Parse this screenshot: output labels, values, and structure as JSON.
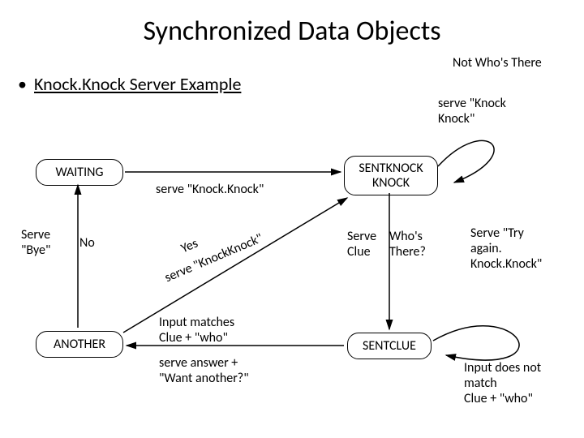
{
  "title": "Synchronized Data Objects",
  "subtitle": "Knock.Knock Server Example",
  "top_right": "Not Who's There",
  "states": {
    "waiting": "WAITING",
    "sentknock": "SENTKNOCK\nKNOCK",
    "another": "ANOTHER",
    "sentclue": "SENTCLUE"
  },
  "labels": {
    "serve_kk_top": "serve \"Knock\nKnock\"",
    "serve_kk_mid": "serve \"Knock.Knock\"",
    "serve_bye": "Serve\n\"Bye\"",
    "no": "No",
    "yes": "Yes",
    "serve_kk_diag": "serve \"KnockKnock\"",
    "whos_there": "Who's\nThere?",
    "serve_clue": "Serve\nClue",
    "try_again": "Serve \"Try\nagain.\nKnock.Knock\"",
    "input_matches": "Input matches\nClue + \"who\"",
    "serve_answer": "serve answer +\n\"Want another?\"",
    "no_match": "Input does not\nmatch\nClue + \"who\""
  }
}
